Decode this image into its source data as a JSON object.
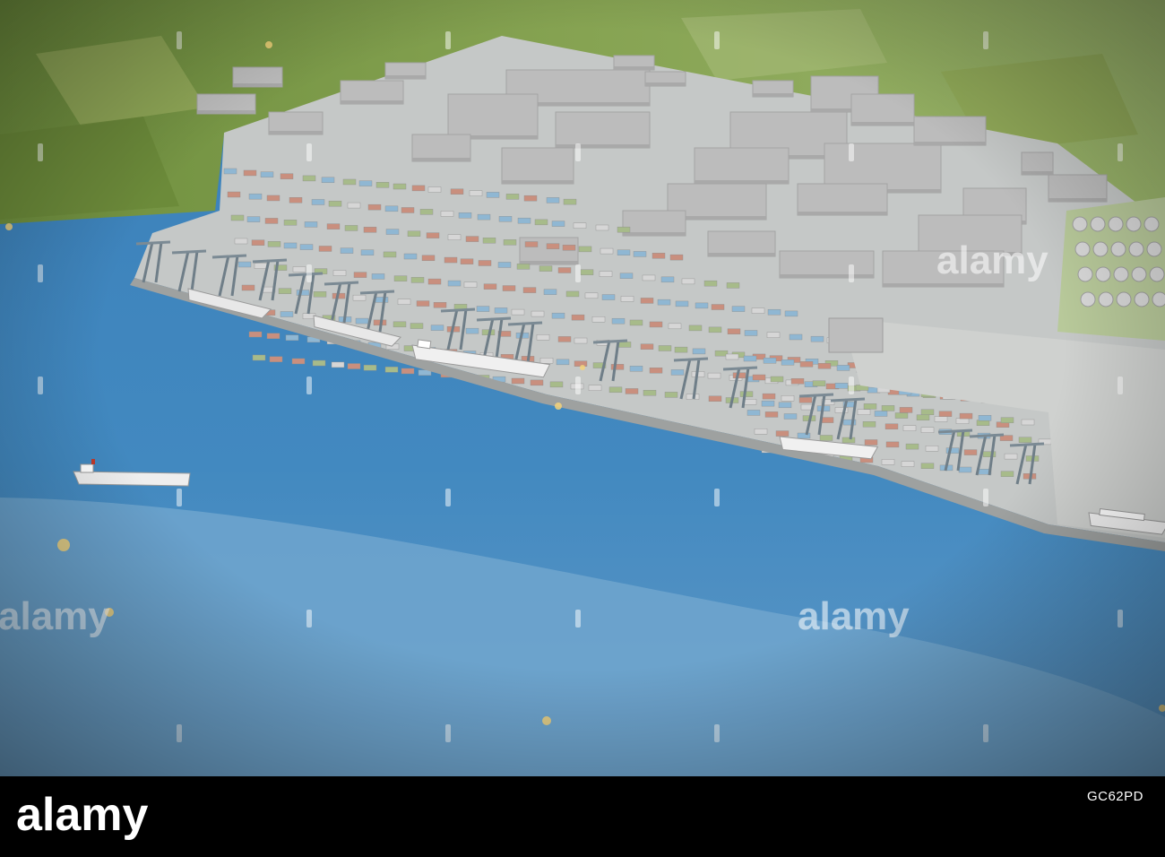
{
  "photo": {
    "subject": "port-terminal-scale-model",
    "watermark_text": "alamy",
    "colors": {
      "sea": "#3f87bf",
      "sea_light": "#7fb0d4",
      "land": "#7d9a4a",
      "quay": "#c4c7c6",
      "building": "#bcbcbc",
      "container_red": "#c98f7e",
      "container_blue": "#8fb7d3",
      "container_green": "#a7bb8a"
    }
  },
  "footer": {
    "logo_text": "alamy",
    "image_id": "GC62PD"
  }
}
